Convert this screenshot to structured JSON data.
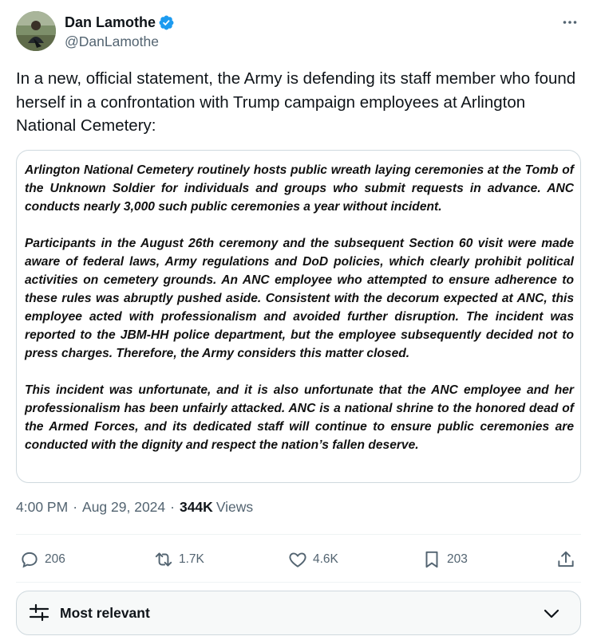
{
  "author": {
    "display_name": "Dan Lamothe",
    "handle": "@DanLamothe",
    "verified": true
  },
  "tweet": {
    "text": "In a new, official statement, the Army is defending its staff member who found herself in a confrontation with Trump campaign employees at Arlington National Cemetery:"
  },
  "statement": {
    "paragraphs": [
      "Arlington National Cemetery routinely hosts public wreath laying ceremonies at the Tomb of the Unknown Soldier for individuals and groups who submit requests in advance. ANC conducts nearly 3,000 such public ceremonies a year without incident.",
      "Participants in the August 26th ceremony and the subsequent Section 60 visit were made aware of federal laws, Army regulations and DoD policies, which clearly prohibit political activities on cemetery grounds. An ANC employee who attempted to ensure adherence to these rules was abruptly pushed aside. Consistent with the decorum expected at ANC, this employee acted with professionalism and avoided further disruption. The incident was reported to the JBM-HH police department, but the employee subsequently decided not to press charges. Therefore, the Army considers this matter closed.",
      "This incident was unfortunate, and it is also unfortunate that the ANC employee and her professionalism has been unfairly attacked. ANC is a national shrine to the honored dead of the Armed Forces, and its dedicated staff will continue to ensure public ceremonies are conducted with the dignity and respect the nation’s fallen deserve."
    ]
  },
  "meta": {
    "time": "4:00 PM",
    "dot1": "·",
    "date": "Aug 29, 2024",
    "dot2": "·",
    "views_count": "344K",
    "views_label": "Views"
  },
  "actions": {
    "replies": "206",
    "reposts": "1.7K",
    "likes": "4.6K",
    "bookmarks": "203"
  },
  "icons": {
    "more": "more-horizontal-icon",
    "verified": "verified-badge-icon",
    "reply": "reply-icon",
    "repost": "repost-icon",
    "like": "heart-icon",
    "bookmark": "bookmark-icon",
    "share": "share-icon",
    "sort": "sliders-icon",
    "chevron": "chevron-down-icon"
  },
  "colors": {
    "verified_blue": "#1d9bf0",
    "secondary_text": "#536471",
    "primary_text": "#0f1419"
  },
  "replies_sort": {
    "label": "Most relevant"
  }
}
